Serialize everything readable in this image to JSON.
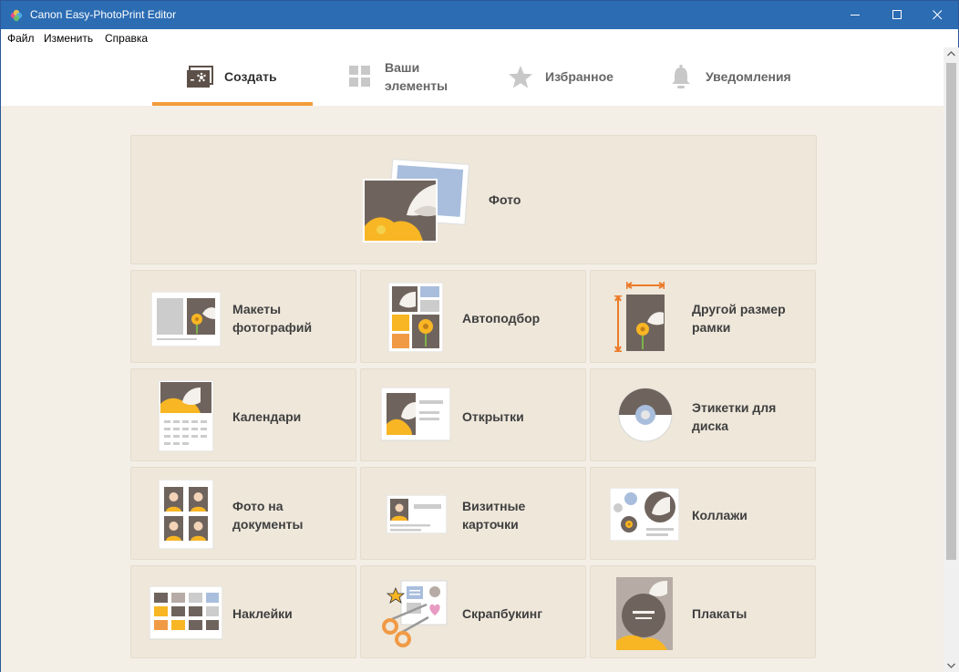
{
  "window": {
    "title": "Canon Easy-PhotoPrint Editor"
  },
  "menu": [
    "Файл",
    "Изменить",
    "Справка"
  ],
  "tabs": [
    {
      "label": "Создать",
      "icon": "create-icon",
      "active": true
    },
    {
      "label_line1": "Ваши",
      "label_line2": "элементы",
      "icon": "grid-icon",
      "active": false
    },
    {
      "label": "Избранное",
      "icon": "star-icon",
      "active": false
    },
    {
      "label": "Уведомления",
      "icon": "bell-icon",
      "active": false
    }
  ],
  "tiles": {
    "photo": "Фото",
    "layouts_1": "Макеты",
    "layouts_2": "фотографий",
    "autofill": "Автоподбор",
    "custom_1": "Другой размер",
    "custom_2": "рамки",
    "calendars": "Календари",
    "cards": "Открытки",
    "disc_1": "Этикетки для",
    "disc_2": "диска",
    "id_1": "Фото на",
    "id_2": "документы",
    "business_1": "Визитные",
    "business_2": "карточки",
    "collages": "Коллажи",
    "stickers": "Наклейки",
    "scrapbooking": "Скрапбукинг",
    "posters": "Плакаты"
  },
  "colors": {
    "titlebar": "#2b6cb3",
    "accent": "#f39c3a",
    "content_bg": "#f3efe7",
    "tile_bg": "#eee7da",
    "photo_brown": "#6f645d",
    "flower_yellow": "#f8b624",
    "sky_blue": "#a9bedd"
  }
}
